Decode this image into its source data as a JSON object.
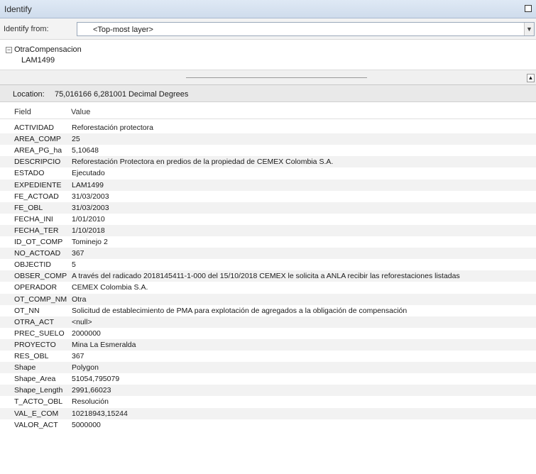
{
  "window": {
    "title": "Identify"
  },
  "identify_from": {
    "label": "Identify from:",
    "selected": "<Top-most layer>"
  },
  "tree": {
    "layer": "OtraCompensacion",
    "feature": "LAM1499"
  },
  "location": {
    "label": "Location:",
    "value": "75,016166 6,281001 Decimal Degrees"
  },
  "table": {
    "headers": {
      "field": "Field",
      "value": "Value"
    },
    "rows": [
      {
        "field": "ACTIVIDAD",
        "value": "Reforestación protectora"
      },
      {
        "field": "AREA_COMP",
        "value": "25"
      },
      {
        "field": "AREA_PG_ha",
        "value": "5,10648"
      },
      {
        "field": "DESCRIPCIO",
        "value": "Reforestación Protectora en predios de la propiedad de CEMEX Colombia S.A."
      },
      {
        "field": "ESTADO",
        "value": "Ejecutado"
      },
      {
        "field": "EXPEDIENTE",
        "value": "LAM1499"
      },
      {
        "field": "FE_ACTOAD",
        "value": "31/03/2003"
      },
      {
        "field": "FE_OBL",
        "value": "31/03/2003"
      },
      {
        "field": "FECHA_INI",
        "value": "1/01/2010"
      },
      {
        "field": "FECHA_TER",
        "value": "1/10/2018"
      },
      {
        "field": "ID_OT_COMP",
        "value": "Tominejo 2"
      },
      {
        "field": "NO_ACTOAD",
        "value": "367"
      },
      {
        "field": "OBJECTID",
        "value": "5"
      },
      {
        "field": "OBSER_COMP",
        "value": "A través del radicado 2018145411-1-000 del 15/10/2018 CEMEX le solicita a ANLA recibir las reforestaciones listadas"
      },
      {
        "field": "OPERADOR",
        "value": "CEMEX Colombia S.A."
      },
      {
        "field": "OT_COMP_NM",
        "value": "Otra"
      },
      {
        "field": "OT_NN",
        "value": "Solicitud de establecimiento de PMA para explotación de agregados a la obligación de compensación"
      },
      {
        "field": "OTRA_ACT",
        "value": "<null>"
      },
      {
        "field": "PREC_SUELO",
        "value": "2000000"
      },
      {
        "field": "PROYECTO",
        "value": "Mina La Esmeralda"
      },
      {
        "field": "RES_OBL",
        "value": "367"
      },
      {
        "field": "Shape",
        "value": "Polygon"
      },
      {
        "field": "Shape_Area",
        "value": "51054,795079"
      },
      {
        "field": "Shape_Length",
        "value": "2991,66023"
      },
      {
        "field": "T_ACTO_OBL",
        "value": "Resolución"
      },
      {
        "field": "VAL_E_COM",
        "value": "10218943,15244"
      },
      {
        "field": "VALOR_ACT",
        "value": "5000000"
      }
    ]
  }
}
